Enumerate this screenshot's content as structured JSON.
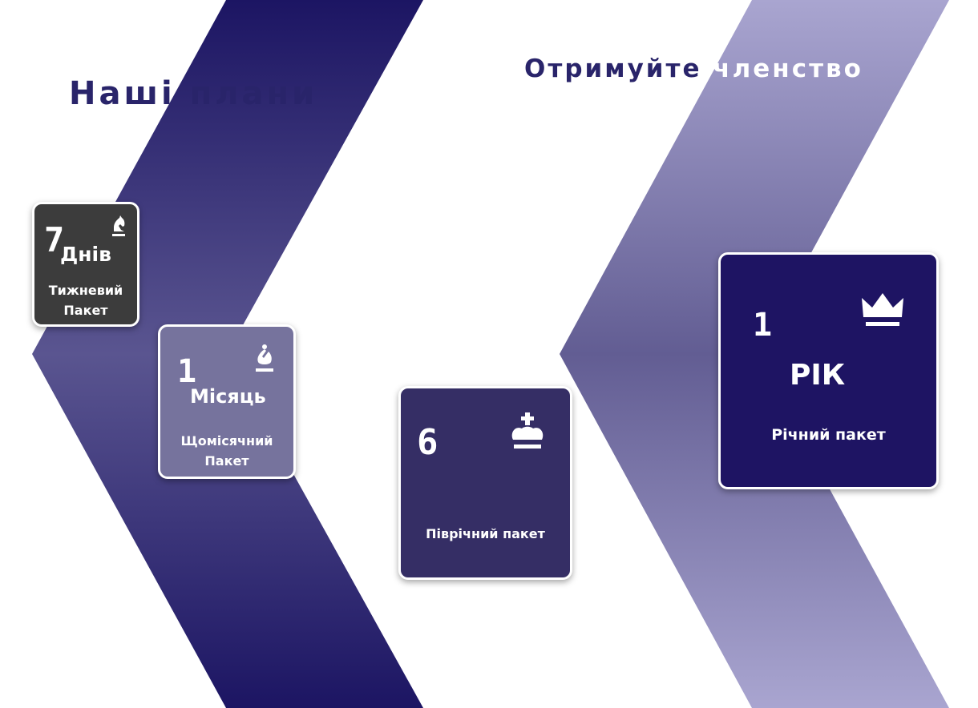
{
  "heading_left": "Наші плани",
  "heading_right": "Отримуйте членство",
  "plans": [
    {
      "number": "7",
      "unit": "Днів",
      "line1": "Тижневий",
      "line2": "Пакет",
      "icon": "chess-knight-icon",
      "color": "#3c3c3c"
    },
    {
      "number": "1",
      "unit": "Місяць",
      "line1": "Щомісячний",
      "line2": "Пакет",
      "icon": "chess-bishop-icon",
      "color": "#76739d"
    },
    {
      "number": "6",
      "line1": "Піврічний пакет",
      "icon": "chess-king-icon",
      "color": "#352e65"
    },
    {
      "number": "1",
      "unit": "РІК",
      "line1": "Річний пакет",
      "icon": "crown-icon",
      "color": "#1e1463"
    }
  ],
  "colors": {
    "heading": "#29246a",
    "left_chevron_dark": "#1c1563",
    "left_chevron_light": "#5a5590",
    "right_chevron_light": "#a9a5d0",
    "right_chevron_mid": "#625d93"
  }
}
